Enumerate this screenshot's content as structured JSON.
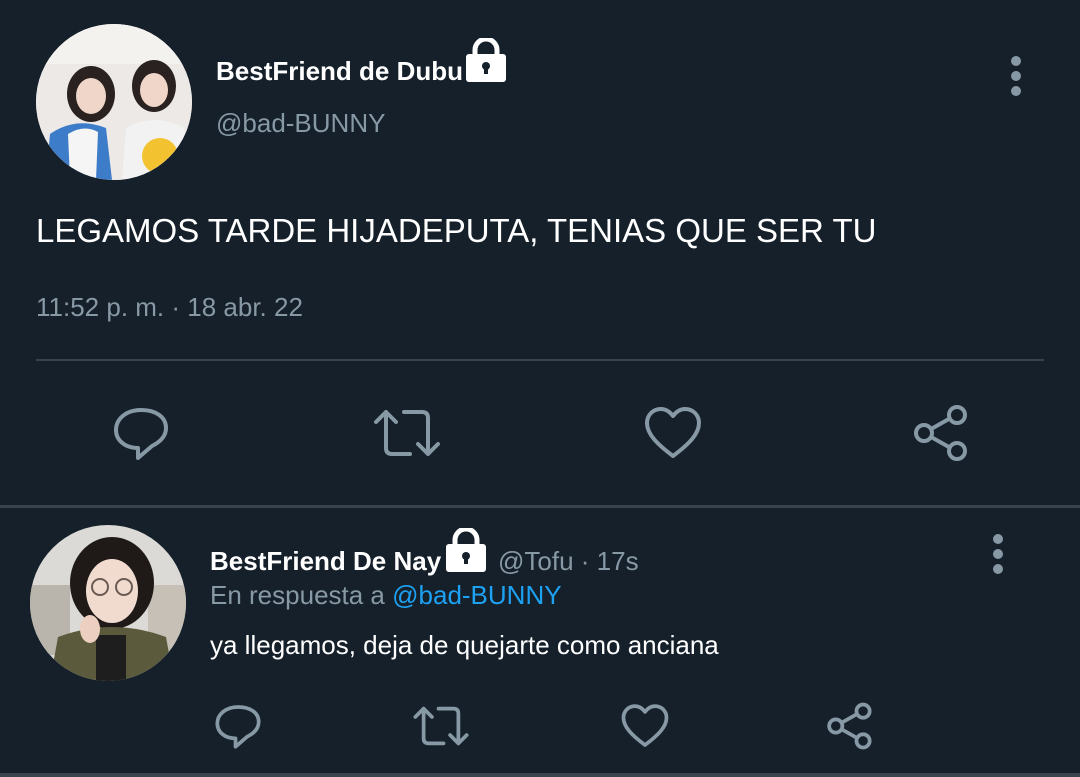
{
  "tweet": {
    "display_name": "BestFriend de Dubu",
    "handle": "@bad-BUNNY",
    "text": "LEGAMOS TARDE HIJADEPUTA, TENIAS QUE SER TU",
    "timestamp": "11:52 p. m. · 18 abr. 22",
    "icons": [
      "reply-icon",
      "retweet-icon",
      "like-icon",
      "share-icon"
    ]
  },
  "reply": {
    "display_name": "BestFriend De Nay",
    "handle_time": "@Tofu · 17s",
    "replying_prefix": "En respuesta a",
    "replying_to": "@bad-BUNNY",
    "text": "ya llegamos, deja de quejarte como anciana",
    "icons": [
      "reply-icon",
      "retweet-icon",
      "like-icon",
      "share-icon"
    ]
  },
  "colors": {
    "background": "#15202b",
    "text": "#ffffff",
    "muted": "#8899a6",
    "link": "#1da1f2",
    "divider": "#38444d"
  }
}
